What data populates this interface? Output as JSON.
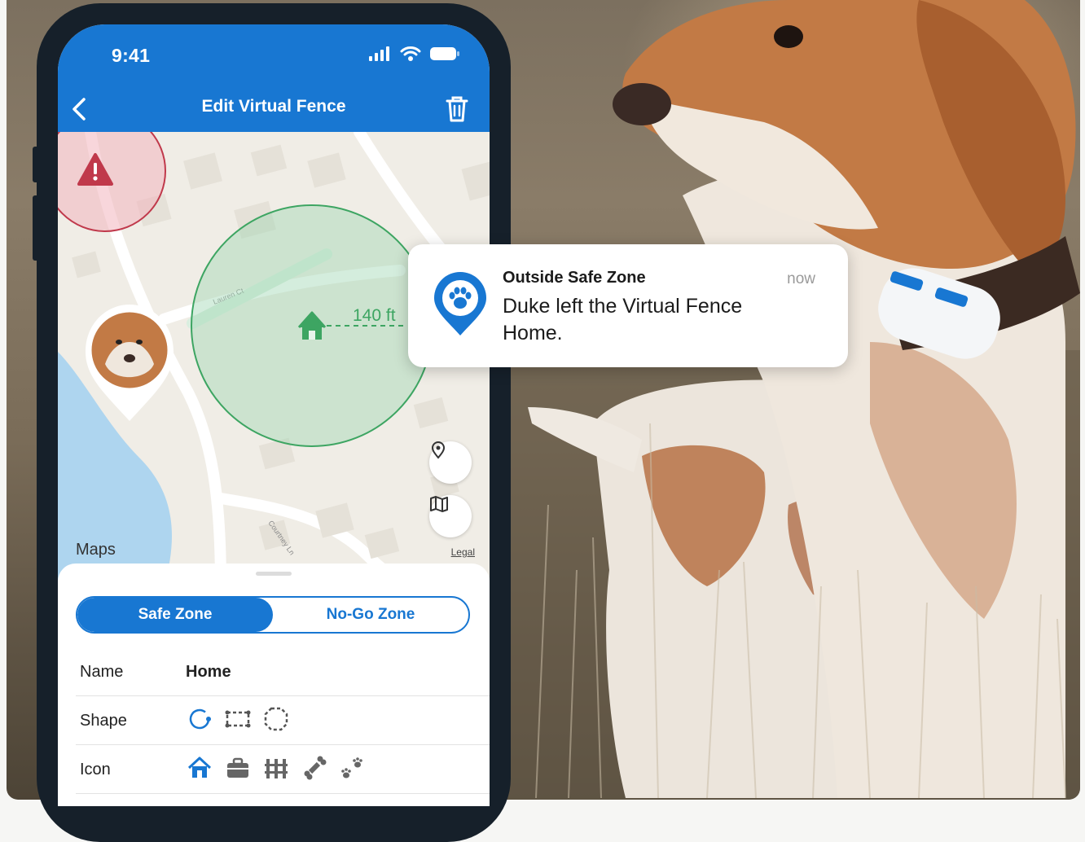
{
  "status_bar": {
    "time": "9:41"
  },
  "app_bar": {
    "title": "Edit Virtual Fence"
  },
  "map": {
    "street_1": "Lauren Ct",
    "street_2": "Courtney Ln",
    "distance": "140 ft",
    "attribution": "Maps",
    "legal": "Legal"
  },
  "zone_toggle": {
    "safe_zone": "Safe Zone",
    "no_go_zone": "No-Go Zone",
    "selected": "Safe Zone"
  },
  "form": {
    "name_label": "Name",
    "name_value": "Home",
    "shape_label": "Shape",
    "icon_label": "Icon",
    "shape_options": [
      "circle-shape-icon",
      "rectangle-shape-icon",
      "polygon-shape-icon"
    ],
    "icon_options": [
      "home-icon",
      "briefcase-icon",
      "fence-icon",
      "bone-icon",
      "paw-prints-icon"
    ]
  },
  "notification": {
    "title": "Outside Safe Zone",
    "time": "now",
    "body": "Duke left the Virtual Fence Home."
  },
  "colors": {
    "primary": "#1877d2",
    "safe_zone": "#3da562",
    "no_go_zone": "#c0394b"
  }
}
